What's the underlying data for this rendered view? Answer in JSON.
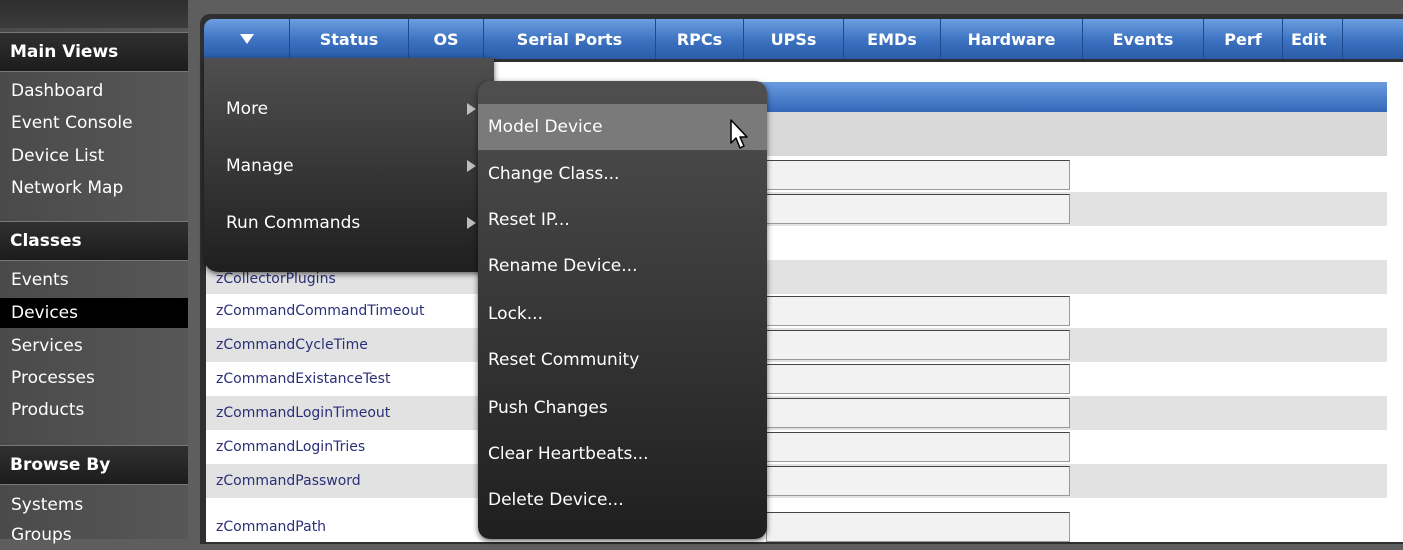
{
  "sidebar": {
    "sections": [
      {
        "title": "Main Views",
        "items": [
          "Dashboard",
          "Event Console",
          "Device List",
          "Network Map"
        ]
      },
      {
        "title": "Classes",
        "items": [
          "Events",
          "Devices",
          "Services",
          "Processes",
          "Products"
        ]
      },
      {
        "title": "Browse By",
        "items": [
          "Systems",
          "Groups"
        ]
      }
    ],
    "selected_item": "Devices"
  },
  "tabs": [
    "Status",
    "OS",
    "Serial Ports",
    "RPCs",
    "UPSs",
    "EMDs",
    "Hardware",
    "Events",
    "Perf",
    "Edit"
  ],
  "rows": [
    "zCollectorPlugins",
    "zCommandCommandTimeout",
    "zCommandCycleTime",
    "zCommandExistanceTest",
    "zCommandLoginTimeout",
    "zCommandLoginTries",
    "zCommandPassword",
    "zCommandPath"
  ],
  "menu_level1": [
    {
      "label": "More"
    },
    {
      "label": "Manage"
    },
    {
      "label": "Run Commands"
    }
  ],
  "menu_level2": [
    {
      "label": "Model Device"
    },
    {
      "label": "Change Class..."
    },
    {
      "label": "Reset IP..."
    },
    {
      "label": "Rename Device..."
    },
    {
      "label": "Lock..."
    },
    {
      "label": "Reset Community"
    },
    {
      "label": "Push Changes"
    },
    {
      "label": "Clear Heartbeats..."
    },
    {
      "label": "Delete Device..."
    }
  ],
  "hovered_menu_item": "Model Device",
  "icons": {
    "tab_menu": "triangle-down-icon",
    "submenu": "chevron-right-icon",
    "pointer": "mouse-cursor-icon"
  },
  "colors": {
    "tab_blue": "#3e74c2",
    "link_text": "#2b2f78",
    "menu_bg": "#2a2a2a",
    "hover": "#7a7a7a"
  }
}
